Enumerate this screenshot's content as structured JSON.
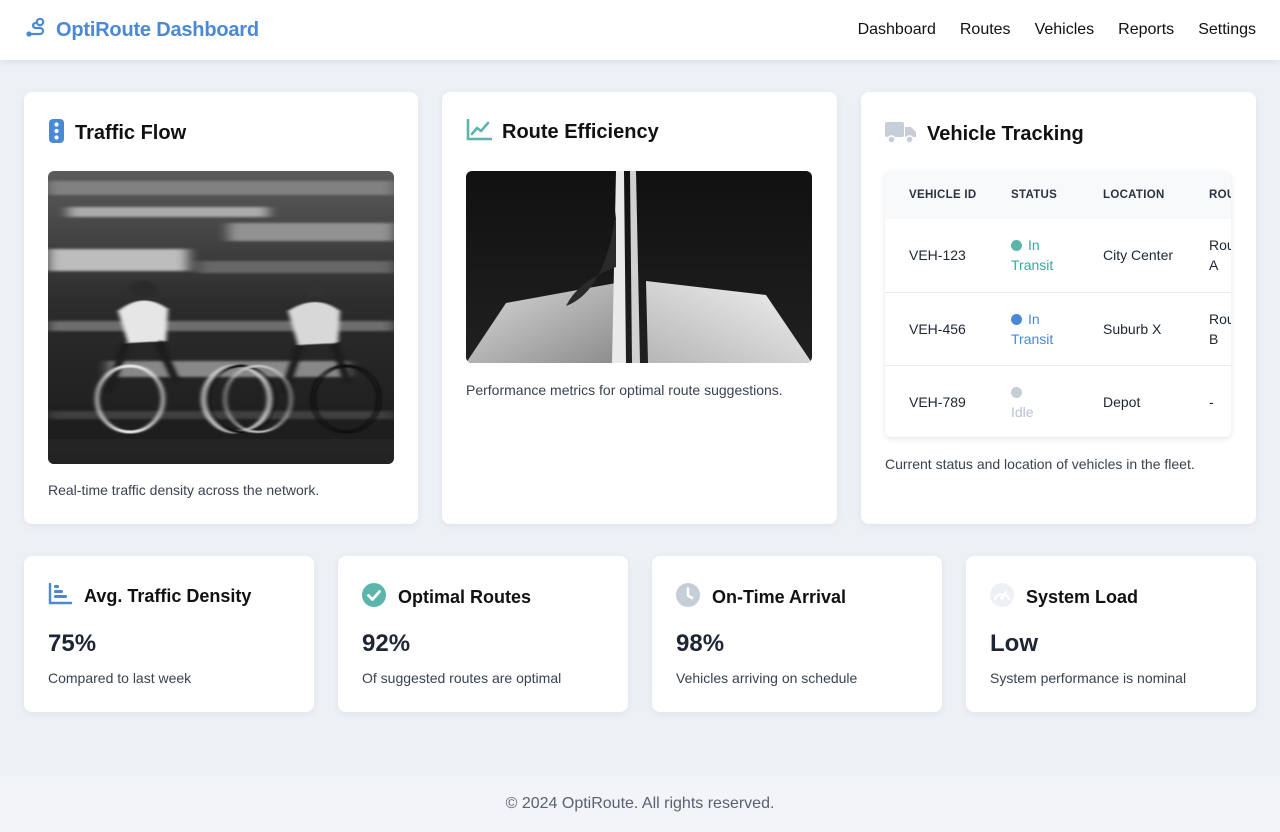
{
  "app": {
    "title": "OptiRoute Dashboard",
    "icon": "route-icon",
    "accent": "#4a89d4"
  },
  "nav": [
    {
      "label": "Dashboard"
    },
    {
      "label": "Routes"
    },
    {
      "label": "Vehicles"
    },
    {
      "label": "Reports"
    },
    {
      "label": "Settings"
    }
  ],
  "cards": {
    "traffic": {
      "title": "Traffic Flow",
      "icon": "traffic-light-icon",
      "caption": "Real-time traffic density across the network.",
      "image": "blurred-cyclists-photo"
    },
    "efficiency": {
      "title": "Route Efficiency",
      "icon": "line-chart-icon",
      "caption": "Performance metrics for optimal route suggestions.",
      "image": "architecture-photo"
    },
    "tracking": {
      "title": "Vehicle Tracking",
      "icon": "truck-icon",
      "caption": "Current status and location of vehicles in the fleet.",
      "table": {
        "headers": [
          "VEHICLE ID",
          "STATUS",
          "LOCATION",
          "ROUTE"
        ],
        "rows": [
          {
            "id": "VEH-123",
            "status": "In Transit",
            "status_color": "#3aa99f",
            "location": "City Center",
            "route": "Route A"
          },
          {
            "id": "VEH-456",
            "status": "In Transit",
            "status_color": "#4a89d4",
            "location": "Suburb X",
            "route": "Route B"
          },
          {
            "id": "VEH-789",
            "status": "Idle",
            "status_color": "#c6ced8",
            "location": "Depot",
            "route": "-"
          }
        ]
      }
    }
  },
  "stats": [
    {
      "title": "Avg. Traffic Density",
      "icon": "bar-chart-icon",
      "value": "75%",
      "note": "Compared to last week"
    },
    {
      "title": "Optimal Routes",
      "icon": "check-circle-icon",
      "value": "92%",
      "note": "Of suggested routes are optimal"
    },
    {
      "title": "On-Time Arrival",
      "icon": "clock-icon",
      "value": "98%",
      "note": "Vehicles arriving on schedule"
    },
    {
      "title": "System Load",
      "icon": "gauge-icon",
      "value": "Low",
      "note": "System performance is nominal"
    }
  ],
  "footer": {
    "text": "© 2024 OptiRoute. All rights reserved."
  }
}
